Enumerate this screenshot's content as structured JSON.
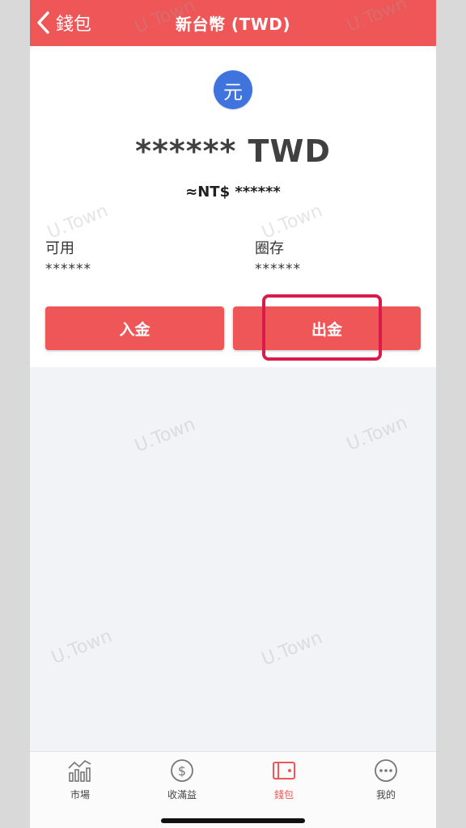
{
  "header": {
    "back_label": "錢包",
    "title": "新台幣 (TWD)"
  },
  "coin": {
    "glyph": "元",
    "color": "#3f73dd"
  },
  "balance": {
    "main": "****** TWD",
    "fiat": "≈NT$ ******"
  },
  "stats": {
    "available_label": "可用",
    "available_value": "******",
    "frozen_label": "圈存",
    "frozen_value": "******"
  },
  "actions": {
    "deposit_label": "入金",
    "withdraw_label": "出金"
  },
  "watermark": "U.Town",
  "tabs": [
    {
      "label": "市場",
      "icon": "market-chart-icon"
    },
    {
      "label": "收滿益",
      "icon": "dollar-coin-icon"
    },
    {
      "label": "錢包",
      "icon": "wallet-icon"
    },
    {
      "label": "我的",
      "icon": "more-dots-icon"
    }
  ],
  "colors": {
    "accent": "#ef5657",
    "highlight": "#d81b4a"
  }
}
